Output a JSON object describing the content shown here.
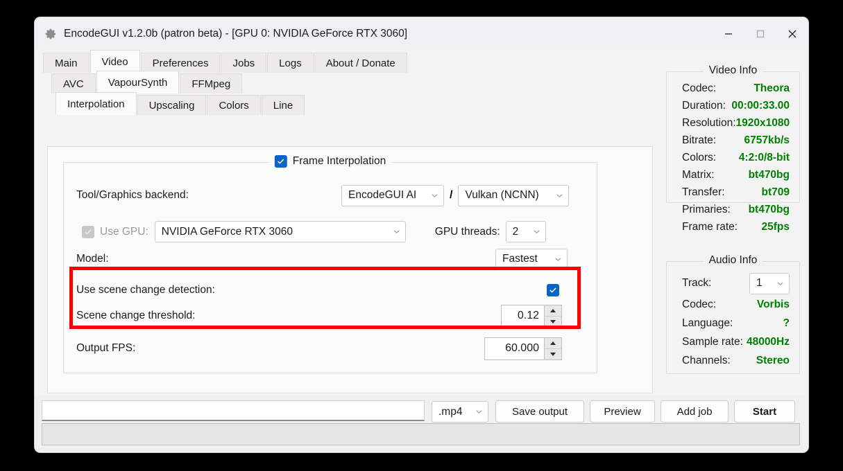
{
  "window": {
    "title": "EncodeGUI v1.2.0b (patron beta) - [GPU 0: NVIDIA GeForce RTX 3060]",
    "icon": "gear-icon",
    "controls": {
      "minimize": "minimize-icon",
      "maximize": "maximize-icon",
      "close": "close-icon"
    }
  },
  "tabs_main": [
    {
      "label": "Main",
      "active": false
    },
    {
      "label": "Video",
      "active": true
    },
    {
      "label": "Preferences",
      "active": false
    },
    {
      "label": "Jobs",
      "active": false
    },
    {
      "label": "Logs",
      "active": false
    },
    {
      "label": "About / Donate",
      "active": false
    }
  ],
  "tabs_sub": [
    {
      "label": "AVC",
      "active": false
    },
    {
      "label": "VapourSynth",
      "active": true
    },
    {
      "label": "FFMpeg",
      "active": false
    }
  ],
  "tabs_inner": [
    {
      "label": "Interpolation",
      "active": true
    },
    {
      "label": "Upscaling",
      "active": false
    },
    {
      "label": "Colors",
      "active": false
    },
    {
      "label": "Line",
      "active": false
    }
  ],
  "interpolation": {
    "group_title": "Frame Interpolation",
    "group_checked": true,
    "backend_label": "Tool/Graphics backend:",
    "backend_tool": "EncodeGUI AI",
    "backend_separator": "/",
    "backend_graphics": "Vulkan (NCNN)",
    "use_gpu_label": "Use GPU:",
    "use_gpu_checked": true,
    "use_gpu_disabled": true,
    "gpu_device": "NVIDIA GeForce RTX 3060",
    "gpu_threads_label": "GPU threads:",
    "gpu_threads": "2",
    "model_label": "Model:",
    "model_value": "Fastest",
    "scene_detect_label": "Use scene change detection:",
    "scene_detect_checked": true,
    "scene_threshold_label": "Scene change threshold:",
    "scene_threshold_value": "0.12",
    "output_fps_label": "Output FPS:",
    "output_fps_value": "60.000"
  },
  "highlight_color": "#ff0000",
  "accent_color": "#0a64c8",
  "info_value_color": "#008000",
  "video_info": {
    "title": "Video Info",
    "rows": [
      {
        "key": "Codec:",
        "value": "Theora"
      },
      {
        "key": "Duration:",
        "value": "00:00:33.00"
      },
      {
        "key": "Resolution:",
        "value": "1920x1080"
      },
      {
        "key": "Bitrate:",
        "value": "6757kb/s"
      },
      {
        "key": "Colors:",
        "value": "4:2:0/8-bit"
      },
      {
        "key": "Matrix:",
        "value": "bt470bg"
      },
      {
        "key": "Transfer:",
        "value": "bt709"
      },
      {
        "key": "Primaries:",
        "value": "bt470bg"
      },
      {
        "key": "Frame rate:",
        "value": "25fps"
      }
    ]
  },
  "audio_info": {
    "title": "Audio Info",
    "track_label": "Track:",
    "track_value": "1",
    "rows": [
      {
        "key": "Codec:",
        "value": "Vorbis"
      },
      {
        "key": "Language:",
        "value": "?"
      },
      {
        "key": "Sample rate:",
        "value": "48000Hz"
      },
      {
        "key": "Channels:",
        "value": "Stereo"
      }
    ]
  },
  "bottom": {
    "output_path": "",
    "output_path_placeholder": "",
    "container": ".mp4",
    "save_output": "Save output",
    "preview": "Preview",
    "add_job": "Add job",
    "start": "Start",
    "progress_text": ""
  }
}
